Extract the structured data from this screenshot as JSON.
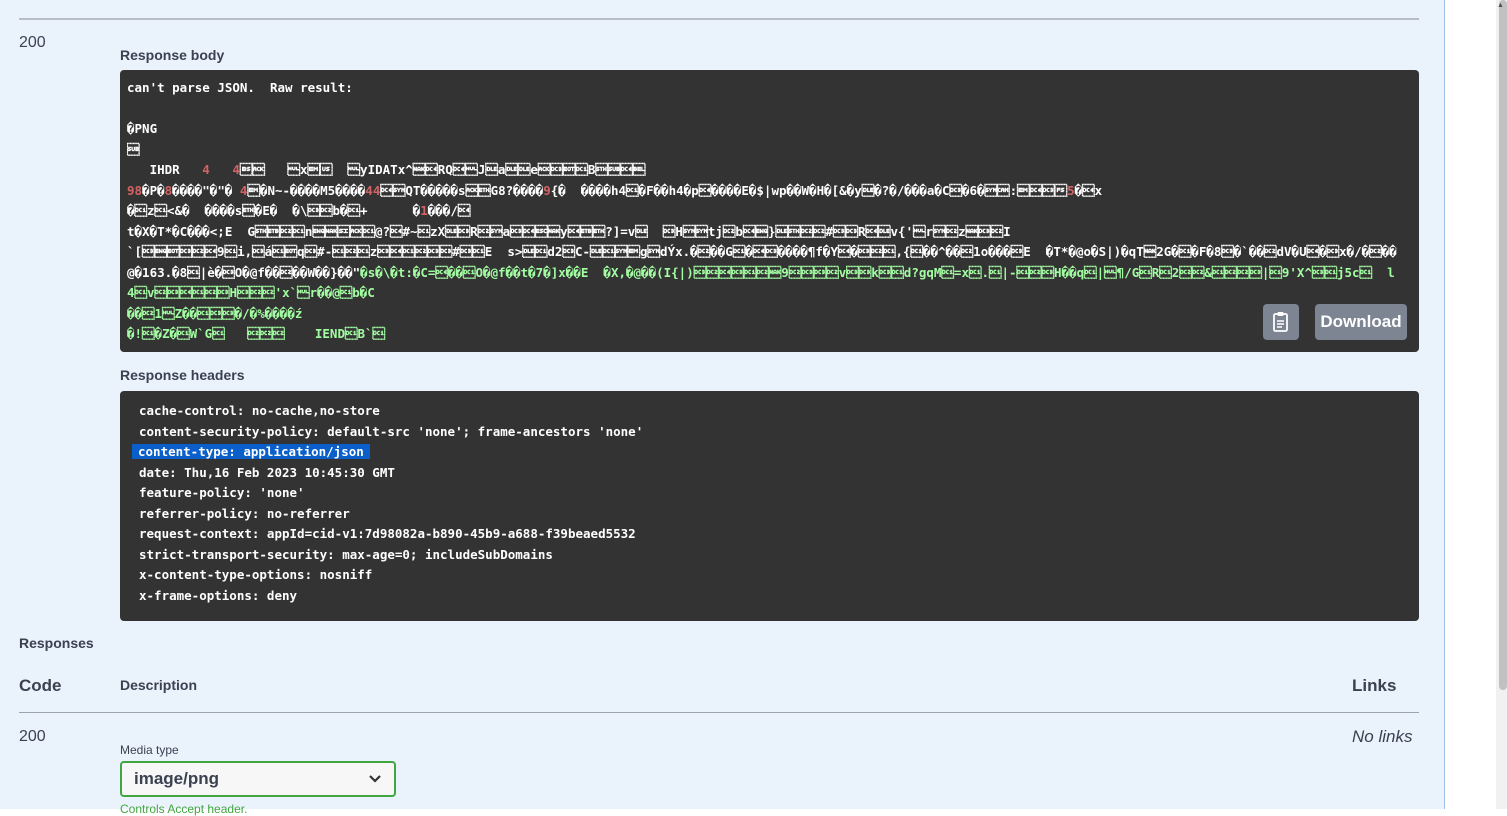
{
  "response": {
    "status_code": "200",
    "body_label": "Response body",
    "body_lines": [
      [
        {
          "t": "can't parse JSON.  Raw result:"
        }
      ],
      [
        {
          "t": ""
        }
      ],
      [
        {
          "t": "�PNG"
        }
      ],
      [
        {
          "t": "\u001a"
        }
      ],
      [
        {
          "t": "   IHDR   "
        },
        {
          "t": "4",
          "c": "r"
        },
        {
          "t": "   "
        },
        {
          "t": "4",
          "c": "r"
        },
        {
          "t": "\b\u0006   \u0000x\u0019\u001f  \u0000yIDATx^\u0015\u0014RQ\u0014\u0000J\u0010a\u0010\u0010e\u0006\u0013\u0004\u0011B\u0002\u001a\u0014\u0007"
        }
      ],
      [
        {
          "t": "98",
          "c": "r"
        },
        {
          "t": "�P�"
        },
        {
          "t": "8",
          "c": "r"
        },
        {
          "t": "����\"�\"� "
        },
        {
          "t": "4",
          "c": "r"
        },
        {
          "t": "\u0019�N~-����M5����"
        },
        {
          "t": "44",
          "c": "r"
        },
        {
          "t": "\u0014\u0016QT�����s\u0006\u0003G8?����"
        },
        {
          "t": "9",
          "c": "r"
        },
        {
          "t": "{�  ����h4\u0011�F��h4�p\u0014����E�$|wp��W�H�[&�y\u0010�?�/���a�C\u0013�6�\u0016\u0018:\u0019\u0014\u0013\u001c"
        },
        {
          "t": "5",
          "c": "r"
        },
        {
          "t": "�\u0014x"
        }
      ],
      [
        {
          "t": "�\u0011z\u0011<&�  ����s\u0003�E�  �\\\u0013\u0012b�\u0011+      �"
        },
        {
          "t": "1",
          "c": "r"
        },
        {
          "t": "���/\u0014"
        }
      ],
      [
        {
          "t": "t�X�T*�C���<;E  G\u0002\u0017\u0012\u0011n\u0005\u0015\u000f\u0006\u0011@?\u0014#~\u0011zX\u0010\u0013R\u0012\u0016a\u0013\u0014\u001b\u0015y\u0014\u0017\u0003?]=v\u0010  \u0013H\u0016\u0016tj\u0012b\u0014\u0005}\u0010\u0002\u0012\u0012#\u0013\u0013R\u0014\u0010v{'\u0000r\u0016\u0012z\u0015\u0013\u0012I"
        }
      ],
      [
        {
          "t": "`[\u0013\u0005\u0004\u0013\u0012\u00149\u0011i,\u0013á\u0011\u0004q\u0013#-\u0011\u0012\u0011z\u0013\u0014\u0011\u0012\u0013\u0013#\u0013\u0011E  s>\u0010\u0011d2\u0013C-\u0010\u0011\u0016\u0019g\u0016dÝx.�\u0012��G\u0011�\u0014\u0013����¶f�Y\u0014�\u0013\u0012\u0011,{\u0011��^��\u00121o���\u0013E  �T*�@o�S|)�qT\u00152G�\u0011�F�8\u0013�`��\u0012dV�U\u0014�\u0013x�/�\u0012��"
        },
        {
          "t": ""
        }
      ],
      [
        {
          "t": "@�163.�8\u0011|è�\u0013O�@f��\u0012��W��}��\""
        },
        {
          "t": "�s�\\�t:�C=\u0014��\u0011O�@f��t�7�]x��E  �X,�@��(I{|)\u0013\u0012\u0014\u0013\u0011\u0012\u00159\u0012\u0013\u0013\u0012v\u0013\u0013k\u0013\u0011d?gqM\u0011=x\u0011.\u0011|-\u0011\u0012\u0013H��q\u0011|\u0000¶/G\u0011R\u00112\u0012\u0012&\u0011\u0012\u0012\u0013|\u00119'X^\u0013\u0011j5c\u0011  l",
          "c": "g"
        }
      ],
      [
        {
          "t": "4\u0011v\u0012\u0013\u0014\u0011\u0012\u0013H\u0013\u0012\u0012'x`\u0000r��@\u0011b�C",
          "c": "g"
        }
      ],
      [
        {
          "t": "��\u00121\u0000Z��\u0011\u0013\u0013�/�%����ź",
          "c": "g"
        }
      ],
      [
        {
          "t": "�!\u0011�Z�\u0011W`G\u0011   \u0012\u0012\u0012    IEND\u0011B`\u0011",
          "c": "g"
        }
      ]
    ],
    "headers_label": "Response headers",
    "headers": [
      "cache-control: no-cache,no-store",
      "content-security-policy: default-src 'none'; frame-ancestors 'none'",
      "content-type: application/json",
      "date: Thu,16 Feb 2023 10:45:30 GMT",
      "feature-policy: 'none'",
      "referrer-policy: no-referrer",
      "request-context: appId=cid-v1:7d98082a-b890-45b9-a688-f39beaed5532",
      "strict-transport-security: max-age=0; includeSubDomains",
      "x-content-type-options: nosniff",
      "x-frame-options: deny"
    ],
    "highlighted_header_index": 2,
    "download_label": "Download",
    "copy_icon": "clipboard-copy-icon"
  },
  "responses": {
    "title": "Responses",
    "col_code": "Code",
    "col_description": "Description",
    "col_links": "Links",
    "row_code": "200",
    "no_links": "No links",
    "media_type_label": "Media type",
    "media_type_value": "image/png",
    "controls_note": "Controls Accept header."
  },
  "colors": {
    "page_bg": "#eaf2fc",
    "code_bg": "#333333",
    "green_text": "#a2fca2",
    "red_text": "#d36363",
    "highlight": "#0b5fcb",
    "button_bg": "#7d8492",
    "select_border": "#41a641"
  }
}
